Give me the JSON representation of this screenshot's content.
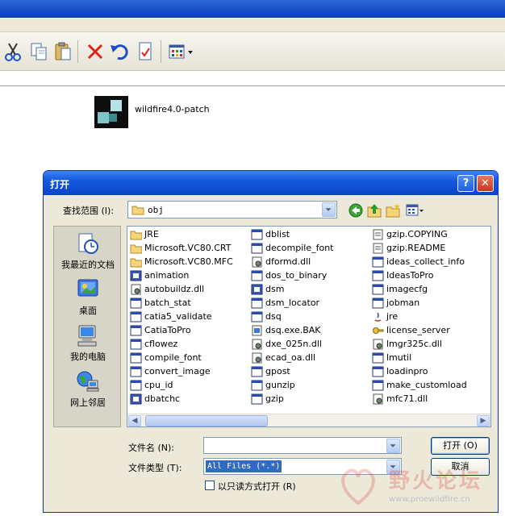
{
  "background_window": {
    "file_name": "wildfire4.0-patch",
    "toolbar_icons": [
      "cut-icon",
      "copy-icon",
      "paste-icon",
      "delete-icon",
      "undo-icon",
      "properties-icon",
      "views-icon"
    ]
  },
  "dialog": {
    "title": "打开",
    "help_btn": "?",
    "close_btn": "✕",
    "look_in_label": "查找范围 (I):",
    "look_in_value": "obj",
    "places": [
      {
        "label": "我最近的文档",
        "icon": "recent-documents-icon"
      },
      {
        "label": "桌面",
        "icon": "desktop-icon"
      },
      {
        "label": "我的电脑",
        "icon": "my-computer-icon"
      },
      {
        "label": "网上邻居",
        "icon": "network-places-icon"
      }
    ],
    "files": {
      "col1": [
        {
          "name": "JRE",
          "type": "folder"
        },
        {
          "name": "Microsoft.VC80.CRT",
          "type": "folder"
        },
        {
          "name": "Microsoft.VC80.MFC",
          "type": "folder"
        },
        {
          "name": "animation",
          "type": "app"
        },
        {
          "name": "autobuildz.dll",
          "type": "dll"
        },
        {
          "name": "batch_stat",
          "type": "exe"
        },
        {
          "name": "catia5_validate",
          "type": "exe"
        },
        {
          "name": "CatiaToPro",
          "type": "exe"
        },
        {
          "name": "cflowez",
          "type": "exe"
        },
        {
          "name": "compile_font",
          "type": "exe"
        },
        {
          "name": "convert_image",
          "type": "exe"
        },
        {
          "name": "cpu_id",
          "type": "exe"
        },
        {
          "name": "dbatchc",
          "type": "app"
        }
      ],
      "col2": [
        {
          "name": "dblist",
          "type": "exe"
        },
        {
          "name": "decompile_font",
          "type": "exe"
        },
        {
          "name": "dformd.dll",
          "type": "dll"
        },
        {
          "name": "dos_to_binary",
          "type": "exe"
        },
        {
          "name": "dsm",
          "type": "app"
        },
        {
          "name": "dsm_locator",
          "type": "exe"
        },
        {
          "name": "dsq",
          "type": "exe"
        },
        {
          "name": "dsq.exe.BAK",
          "type": "bak"
        },
        {
          "name": "dxe_025n.dll",
          "type": "dll"
        },
        {
          "name": "ecad_oa.dll",
          "type": "dll"
        },
        {
          "name": "gpost",
          "type": "exe"
        },
        {
          "name": "gunzip",
          "type": "exe"
        },
        {
          "name": "gzip",
          "type": "exe"
        }
      ],
      "col3": [
        {
          "name": "gzip.COPYING",
          "type": "doc"
        },
        {
          "name": "gzip.README",
          "type": "doc"
        },
        {
          "name": "ideas_collect_info",
          "type": "exe"
        },
        {
          "name": "IdeasToPro",
          "type": "exe"
        },
        {
          "name": "imagecfg",
          "type": "exe"
        },
        {
          "name": "jobman",
          "type": "exe"
        },
        {
          "name": "jre",
          "type": "java"
        },
        {
          "name": "license_server",
          "type": "key"
        },
        {
          "name": "lmgr325c.dll",
          "type": "dll"
        },
        {
          "name": "lmutil",
          "type": "exe"
        },
        {
          "name": "loadinpro",
          "type": "exe"
        },
        {
          "name": "make_customload",
          "type": "exe"
        },
        {
          "name": "mfc71.dll",
          "type": "dll"
        }
      ]
    },
    "filename_label": "文件名 (N):",
    "filename_value": "",
    "filetype_label": "文件类型 (T):",
    "filetype_value": "All Files (*.*)",
    "open_btn": "打开 (O)",
    "cancel_btn": "取消",
    "readonly_label": "以只读方式打开 (R)"
  },
  "watermark": {
    "text": "野火论坛",
    "url": "www.proewildfire.cn"
  }
}
